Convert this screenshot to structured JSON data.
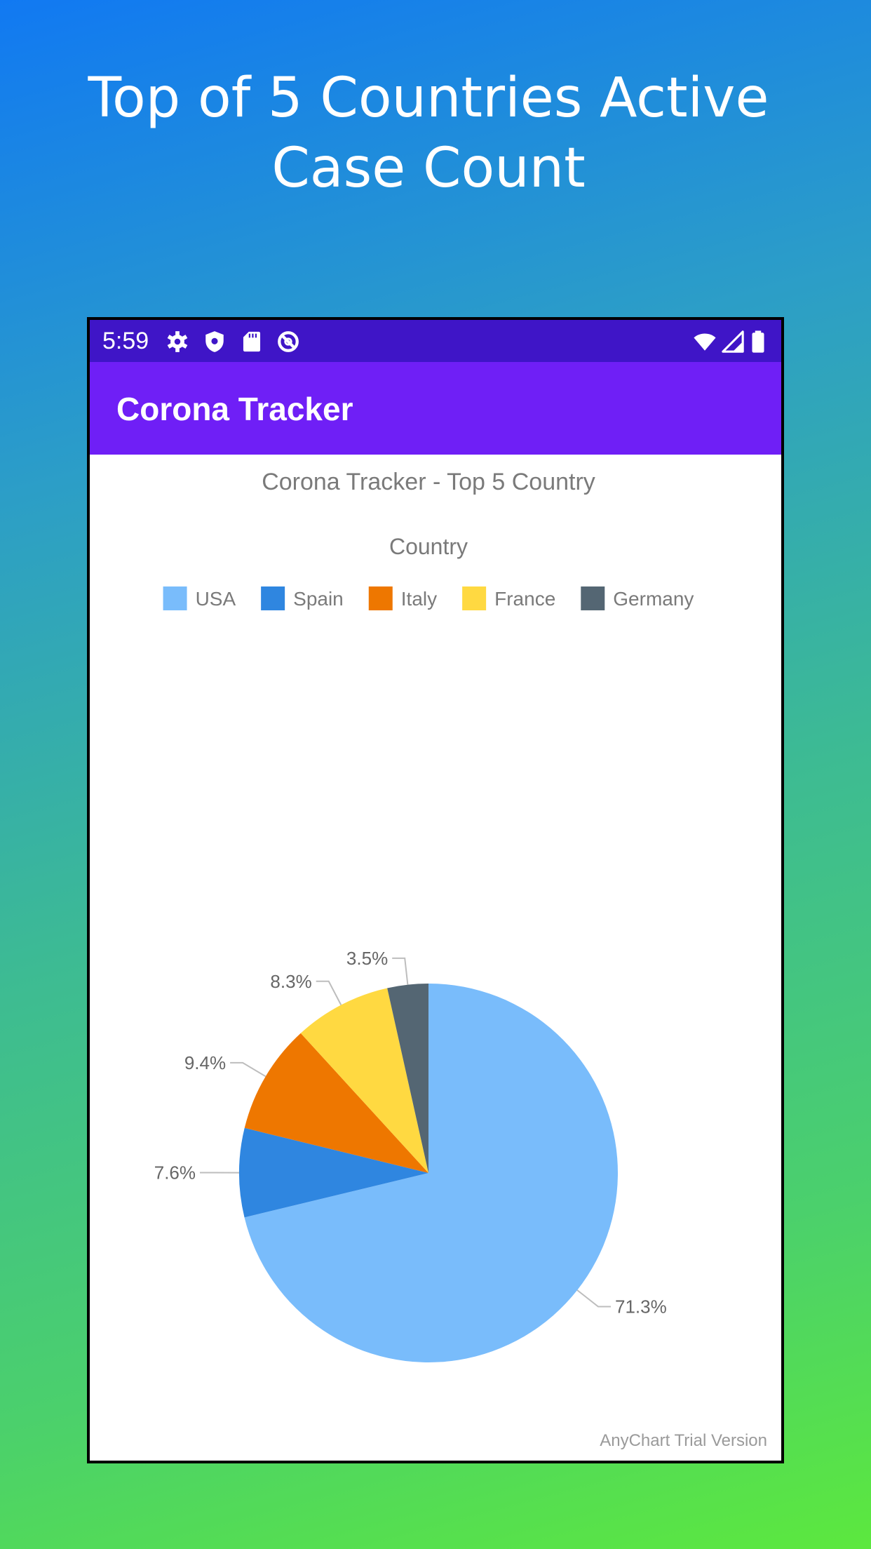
{
  "promo": {
    "title": "Top of 5 Countries Active Case Count"
  },
  "status_bar": {
    "time": "5:59",
    "left_icons": [
      "settings-icon",
      "shield-icon",
      "sd-card-icon",
      "do-not-disturb-icon"
    ],
    "right_icons": [
      "wifi-icon",
      "cell-signal-icon",
      "battery-icon"
    ]
  },
  "app_bar": {
    "title": "Corona Tracker",
    "color": "#6f1ff6",
    "status_color": "#3f15c7"
  },
  "chart_data": {
    "type": "pie",
    "title": "Corona Tracker - Top 5 Country",
    "legend_title": "Country",
    "legend_position": "top",
    "categories": [
      "USA",
      "Spain",
      "Italy",
      "France",
      "Germany"
    ],
    "values": [
      71.3,
      7.6,
      9.4,
      8.3,
      3.5
    ],
    "labels": [
      "71.3%",
      "7.6%",
      "9.4%",
      "8.3%",
      "3.5%"
    ],
    "colors": [
      "#79bcfb",
      "#2f86e0",
      "#ee7700",
      "#ffd941",
      "#546673"
    ],
    "start": "12 o'clock",
    "direction": "clockwise"
  },
  "watermark": "AnyChart Trial Version"
}
